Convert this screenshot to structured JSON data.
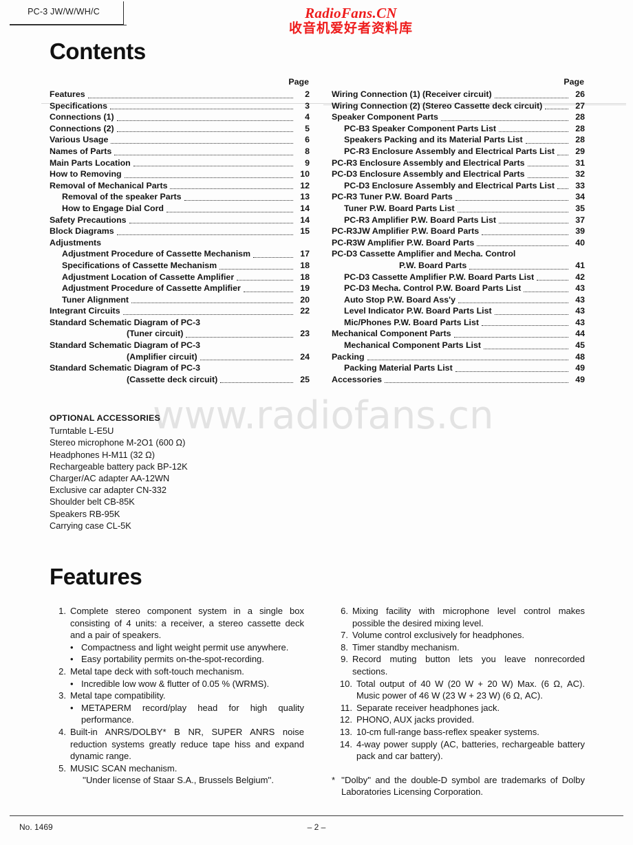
{
  "header": {
    "model_tab": "PC-3 JW/W/WH/C",
    "watermark_en": "RadioFans.CN",
    "watermark_cn": "收音机爱好者资料库",
    "watermark_faint": "www.radiofans.cn",
    "watermark_red_color": "#ee1c1c"
  },
  "contents": {
    "title": "Contents",
    "page_header": "Page",
    "left": [
      {
        "label": "Features",
        "page": "2",
        "indent": 0
      },
      {
        "label": "Specifications",
        "page": "3",
        "indent": 0
      },
      {
        "label": "Connections (1)",
        "page": "4",
        "indent": 0
      },
      {
        "label": "Connections (2)",
        "page": "5",
        "indent": 0
      },
      {
        "label": "Various Usage",
        "page": "6",
        "indent": 0
      },
      {
        "label": "Names of Parts",
        "page": "8",
        "indent": 0
      },
      {
        "label": "Main Parts Location",
        "page": "9",
        "indent": 0
      },
      {
        "label": "How to Removing",
        "page": "10",
        "indent": 0
      },
      {
        "label": "Removal of Mechanical Parts",
        "page": "12",
        "indent": 0
      },
      {
        "label": "Removal of the speaker Parts",
        "page": "13",
        "indent": 1
      },
      {
        "label": "How to Engage Dial Cord",
        "page": "14",
        "indent": 1
      },
      {
        "label": "Safety Precautions",
        "page": "14",
        "indent": 0
      },
      {
        "label": "Block Diagrams",
        "page": "15",
        "indent": 0
      },
      {
        "label": "Adjustments",
        "page": "",
        "indent": 0,
        "dots": false
      },
      {
        "label": "Adjustment Procedure of Cassette Mechanism",
        "page": "17",
        "indent": 1
      },
      {
        "label": "Specifications of Cassette Mechanism",
        "page": "18",
        "indent": 1
      },
      {
        "label": "Adjustment Location of Cassette Amplifier",
        "page": "18",
        "indent": 1
      },
      {
        "label": "Adjustment Procedure of Cassette Amplifier",
        "page": "19",
        "indent": 1
      },
      {
        "label": "Tuner Alignment",
        "page": "20",
        "indent": 1
      },
      {
        "label": "Integrant Circuits",
        "page": "22",
        "indent": 0
      },
      {
        "label": "Standard Schematic Diagram of PC-3",
        "page": "",
        "indent": 0,
        "dots": false
      },
      {
        "label": "(Tuner circuit)",
        "page": "23",
        "indent": 3
      },
      {
        "label": "Standard Schematic Diagram of PC-3",
        "page": "",
        "indent": 0,
        "dots": false
      },
      {
        "label": "(Amplifier circuit)",
        "page": "24",
        "indent": 3
      },
      {
        "label": "Standard Schematic Diagram of PC-3",
        "page": "",
        "indent": 0,
        "dots": false
      },
      {
        "label": "(Cassette deck circuit)",
        "page": "25",
        "indent": 3
      }
    ],
    "right": [
      {
        "label": "Wiring Connection (1) (Receiver circuit)",
        "page": "26",
        "indent": 0
      },
      {
        "label": "Wiring Connection (2) (Stereo Cassette deck circuit)",
        "page": "27",
        "indent": 0
      },
      {
        "label": "Speaker Component Parts",
        "page": "28",
        "indent": 0
      },
      {
        "label": "PC-B3 Speaker Component Parts List",
        "page": "28",
        "indent": 1
      },
      {
        "label": "Speakers Packing and its Material Parts List",
        "page": "28",
        "indent": 1
      },
      {
        "label": "PC-R3 Enclosure Assembly and Electrical Parts List",
        "page": "29",
        "indent": 1
      },
      {
        "label": "PC-R3 Enclosure Assembly and Electrical Parts",
        "page": "31",
        "indent": 0
      },
      {
        "label": "PC-D3 Enclosure Assembly and Electrical Parts",
        "page": "32",
        "indent": 0
      },
      {
        "label": "PC-D3 Enclosure Assembly and Electrical Parts List",
        "page": "33",
        "indent": 1
      },
      {
        "label": "PC-R3 Tuner P.W. Board Parts",
        "page": "34",
        "indent": 0
      },
      {
        "label": "Tuner P.W. Board Parts List",
        "page": "35",
        "indent": 1
      },
      {
        "label": "PC-R3 Amplifier P.W. Board Parts List",
        "page": "37",
        "indent": 1
      },
      {
        "label": "PC-R3JW Amplifier P.W. Board Parts",
        "page": "39",
        "indent": 0
      },
      {
        "label": "PC-R3W Amplifier P.W. Board Parts",
        "page": "40",
        "indent": 0
      },
      {
        "label": "PC-D3 Cassette Amplifier and Mecha. Control",
        "page": "",
        "indent": 0,
        "dots": false
      },
      {
        "label": "P.W. Board Parts",
        "page": "41",
        "indent": 3
      },
      {
        "label": "PC-D3 Cassette Amplifier P.W. Board Parts List",
        "page": "42",
        "indent": 1
      },
      {
        "label": "PC-D3 Mecha. Control P.W. Board Parts List",
        "page": "43",
        "indent": 1
      },
      {
        "label": "Auto Stop P.W. Board Ass'y",
        "page": "43",
        "indent": 1
      },
      {
        "label": "Level Indicator P.W. Board Parts List",
        "page": "43",
        "indent": 1
      },
      {
        "label": "Mic/Phones P.W. Board Parts List",
        "page": "43",
        "indent": 1
      },
      {
        "label": "Mechanical Component Parts",
        "page": "44",
        "indent": 0
      },
      {
        "label": "Mechanical Component Parts List",
        "page": "45",
        "indent": 1
      },
      {
        "label": "Packing",
        "page": "48",
        "indent": 0
      },
      {
        "label": "Packing Material Parts List",
        "page": "49",
        "indent": 1
      },
      {
        "label": "Accessories",
        "page": "49",
        "indent": 0
      }
    ]
  },
  "optional_accessories": {
    "title": "OPTIONAL ACCESSORIES",
    "items": [
      "Turntable L-E5U",
      "Stereo microphone M-2O1 (600 Ω)",
      "Headphones H-M11 (32 Ω)",
      "Rechargeable battery pack BP-12K",
      "Charger/AC adapter AA-12WN",
      "Exclusive car adapter CN-332",
      "Shoulder belt CB-85K",
      "Speakers RB-95K",
      "Carrying case CL-5K"
    ]
  },
  "features": {
    "title": "Features",
    "left": [
      {
        "type": "num",
        "num": "1.",
        "text": "Complete stereo component system in a single box consisting of 4 units: a receiver, a stereo cassette deck and a pair of speakers."
      },
      {
        "type": "bullet",
        "bullet": "•",
        "text": "Compactness and light weight permit use anywhere."
      },
      {
        "type": "bullet",
        "bullet": "•",
        "text": "Easy portability permits on-the-spot-recording."
      },
      {
        "type": "num",
        "num": "2.",
        "text": "Metal tape deck with soft-touch mechanism."
      },
      {
        "type": "bullet",
        "bullet": "•",
        "text": "Incredible low wow & flutter of 0.05 % (WRMS)."
      },
      {
        "type": "num",
        "num": "3.",
        "text": "Metal tape compatibility."
      },
      {
        "type": "bullet",
        "bullet": "•",
        "text": "METAPERM record/play head for high quality performance."
      },
      {
        "type": "num",
        "num": "4.",
        "text": "Built-in ANRS/DOLBY* B NR, SUPER ANRS noise reduction systems greatly reduce tape hiss and expand dynamic range."
      },
      {
        "type": "num",
        "num": "5.",
        "text": "MUSIC SCAN mechanism."
      },
      {
        "type": "quote",
        "text": "''Under license of Staar S.A., Brussels Belgium''."
      }
    ],
    "right": [
      {
        "type": "num",
        "num": "6.",
        "text": "Mixing facility with microphone level control makes possible the desired mixing level."
      },
      {
        "type": "num",
        "num": "7.",
        "text": "Volume control exclusively for headphones."
      },
      {
        "type": "num",
        "num": "8.",
        "text": "Timer standby mechanism."
      },
      {
        "type": "num",
        "num": "9.",
        "text": "Record muting button lets you leave nonrecorded sections."
      },
      {
        "type": "num",
        "num": "10.",
        "text": "Total output of 40 W (20 W + 20 W) Max. (6 Ω, AC). Music power of 46 W (23 W + 23 W) (6 Ω, AC)."
      },
      {
        "type": "num",
        "num": "11.",
        "text": "Separate receiver headphones jack."
      },
      {
        "type": "num",
        "num": "12.",
        "text": "PHONO, AUX jacks provided."
      },
      {
        "type": "num",
        "num": "13.",
        "text": "10-cm full-range bass-reflex speaker systems."
      },
      {
        "type": "num",
        "num": "14.",
        "text": "4-way power supply (AC, batteries, rechargeable battery pack and car battery)."
      }
    ],
    "footnote": {
      "star": "*",
      "text": "''Dolby'' and the double-D symbol are trademarks of Dolby Laboratories Licensing Corporation."
    }
  },
  "footer": {
    "doc_no": "No. 1469",
    "page_marker": "– 2 –"
  }
}
